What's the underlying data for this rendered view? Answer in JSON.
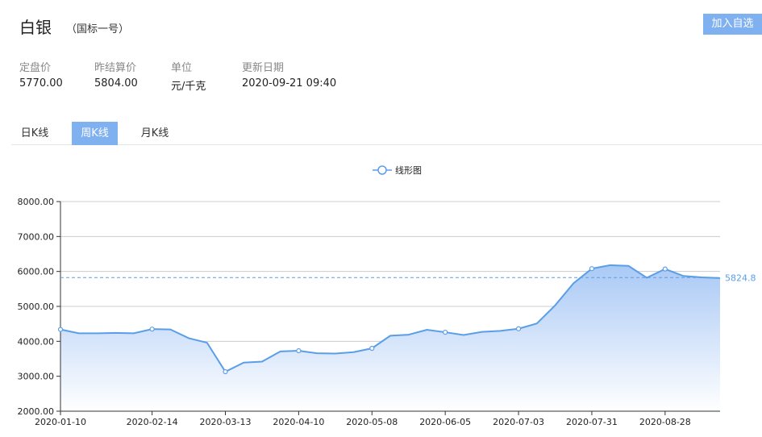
{
  "header": {
    "title": "白银",
    "subtitle": "（国标一号）",
    "add_button": "加入自选"
  },
  "info": [
    {
      "label": "定盘价",
      "value": "5770.00"
    },
    {
      "label": "昨结算价",
      "value": "5804.00"
    },
    {
      "label": "单位",
      "value": "元/千克"
    },
    {
      "label": "更新日期",
      "value": "2020-09-21 09:40"
    }
  ],
  "tabs": [
    {
      "label": "日K线",
      "active": false
    },
    {
      "label": "周K线",
      "active": true
    },
    {
      "label": "月K线",
      "active": false
    }
  ],
  "colors": {
    "accent": "#7fb0f0",
    "line": "#5b9ee8",
    "area_top": "#a9c9f5",
    "area_bottom": "#ffffff"
  },
  "chart_data": {
    "type": "area",
    "legend": [
      "线形图"
    ],
    "legend_position": "top-center",
    "ylim": [
      2000,
      8000
    ],
    "y_ticks": [
      "8000.00",
      "7000.00",
      "6000.00",
      "5000.00",
      "4000.00",
      "3000.00",
      "2000.00"
    ],
    "x_ticks": [
      "2020-01-10",
      "2020-02-14",
      "2020-03-13",
      "2020-04-10",
      "2020-05-08",
      "2020-06-05",
      "2020-07-03",
      "2020-07-31",
      "2020-08-28"
    ],
    "grid": true,
    "reference_line": {
      "value": 5824.8,
      "label": "5824.8"
    },
    "series": [
      {
        "name": "线形图",
        "x": [
          "2020-01-10",
          "2020-01-17",
          "2020-01-24",
          "2020-01-31",
          "2020-02-07",
          "2020-02-14",
          "2020-02-21",
          "2020-02-28",
          "2020-03-06",
          "2020-03-13",
          "2020-03-20",
          "2020-03-27",
          "2020-04-03",
          "2020-04-10",
          "2020-04-17",
          "2020-04-24",
          "2020-05-01",
          "2020-05-08",
          "2020-05-15",
          "2020-05-22",
          "2020-05-29",
          "2020-06-05",
          "2020-06-12",
          "2020-06-19",
          "2020-06-26",
          "2020-07-03",
          "2020-07-10",
          "2020-07-17",
          "2020-07-24",
          "2020-07-31",
          "2020-08-07",
          "2020-08-14",
          "2020-08-21",
          "2020-08-28",
          "2020-09-04",
          "2020-09-11",
          "2020-09-18"
        ],
        "values": [
          4340,
          4230,
          4230,
          4240,
          4230,
          4350,
          4340,
          4090,
          3960,
          3130,
          3390,
          3420,
          3710,
          3730,
          3660,
          3650,
          3690,
          3800,
          4160,
          4190,
          4330,
          4260,
          4180,
          4270,
          4300,
          4360,
          4510,
          5030,
          5660,
          6080,
          6180,
          6160,
          5820,
          6070,
          5870,
          5830,
          5810
        ]
      }
    ]
  }
}
